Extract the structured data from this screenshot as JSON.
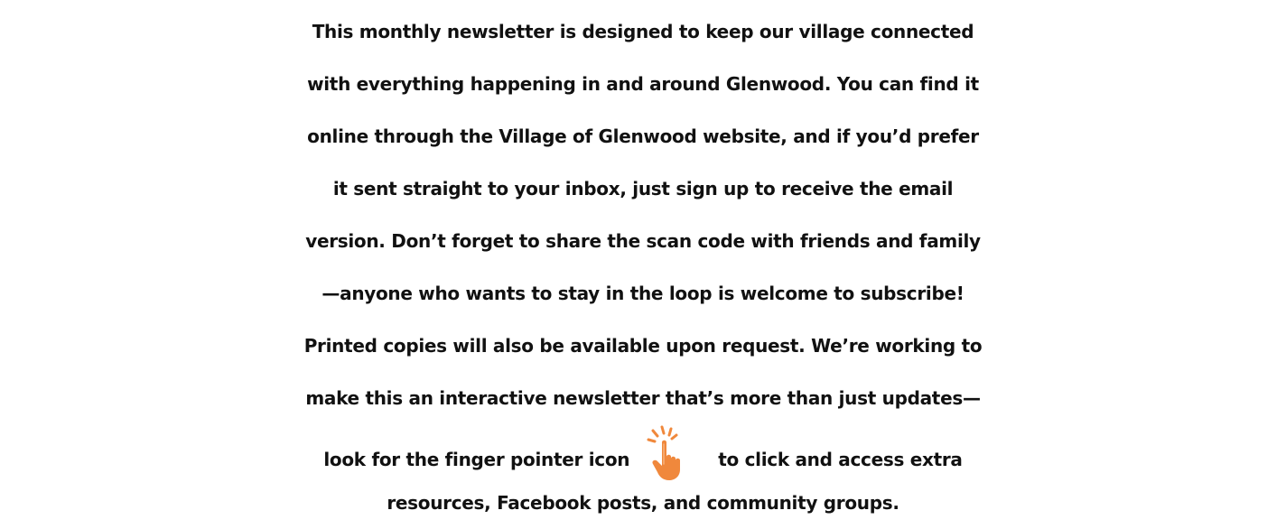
{
  "newsletter": {
    "lines": [
      "This monthly newsletter is designed to keep our village connected",
      "with everything happening in and around Glenwood. You can find it",
      "online through the Village of Glenwood website, and if you’d prefer",
      "it sent straight to your inbox, just sign up to receive the email",
      "version. Don’t forget to share the scan code with friends and family",
      "—anyone who wants to stay in the loop is welcome to subscribe!",
      "Printed copies will also be available upon request. We’re working to",
      "make this an interactive newsletter that’s more than just updates—"
    ],
    "icon_line": {
      "before": "look for the finger pointer icon",
      "after": "to click and access extra"
    },
    "last_line": "resources, Facebook posts, and community groups."
  },
  "icon": {
    "name": "finger-pointer-icon",
    "color": "#f0883c",
    "spark_color": "#f0883c"
  }
}
